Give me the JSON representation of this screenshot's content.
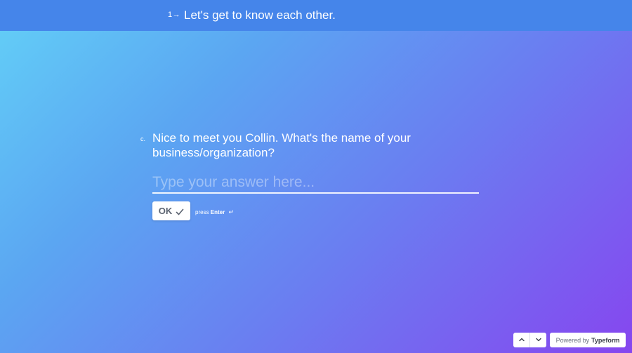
{
  "header": {
    "section_number": "1",
    "section_arrow": "→",
    "section_title": "Let's get to know each other."
  },
  "question": {
    "letter": "c.",
    "text": "Nice to meet you Collin. What's the name of your business/organization?",
    "input_value": "",
    "input_placeholder": "Type your answer here..."
  },
  "actions": {
    "ok_label": "OK",
    "check_icon": "check-icon",
    "press_label": "press",
    "key_label": "Enter",
    "enter_symbol": "↵"
  },
  "footer": {
    "up_icon": "chevron-up-icon",
    "down_icon": "chevron-down-icon",
    "powered_prefix": "Powered by",
    "powered_brand": "Typeform"
  },
  "colors": {
    "topbar": "#4585ea",
    "gradient_start": "#63d0f7",
    "gradient_end": "#8646ef",
    "button_text": "#5b6370"
  }
}
